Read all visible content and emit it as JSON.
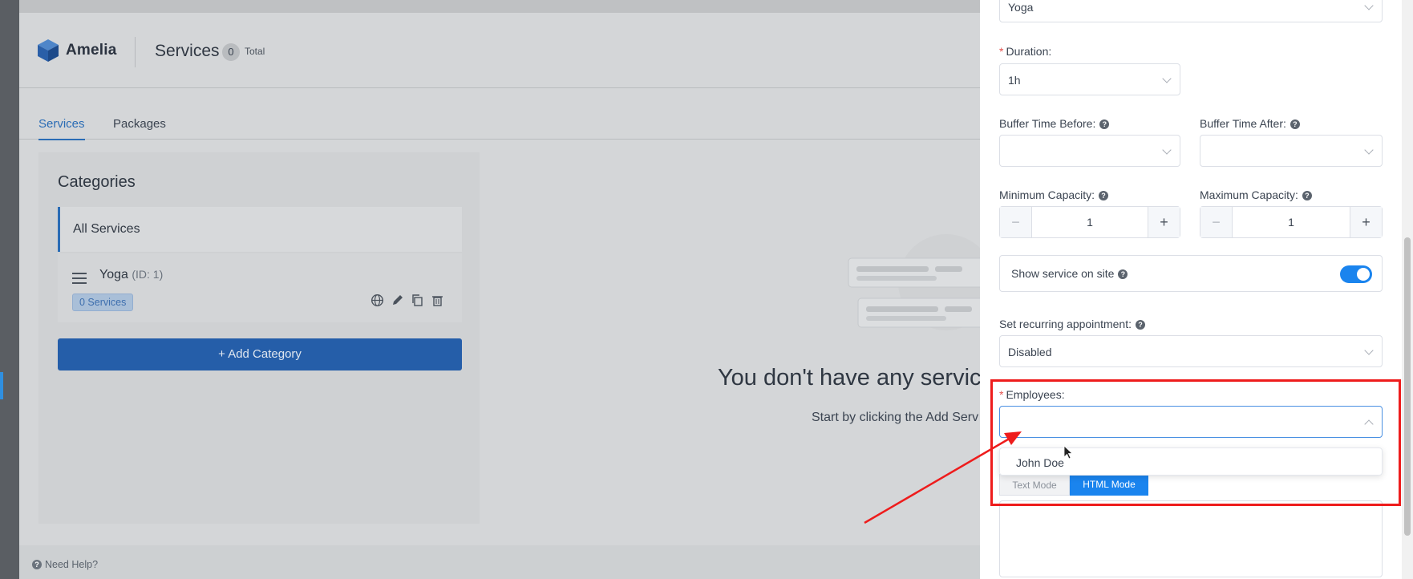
{
  "app": {
    "brand": "Amelia",
    "page_title": "Services",
    "count": "0",
    "count_label": "Total",
    "tabs": [
      {
        "label": "Services",
        "active": true
      },
      {
        "label": "Packages",
        "active": false
      }
    ],
    "categories": {
      "title": "Categories",
      "all_label": "All Services",
      "items": [
        {
          "name": "Yoga",
          "id_label": "(ID: 1)",
          "badge": "0 Services"
        }
      ],
      "add_button": "Add Category"
    },
    "empty": {
      "title": "You don't have any servic",
      "subtitle": "Start by clicking the Add Serv"
    },
    "help": "Need Help?"
  },
  "drawer": {
    "category_value": "Yoga",
    "duration": {
      "label": "Duration:",
      "value": "1h"
    },
    "buffer_before": {
      "label": "Buffer Time Before:",
      "value": ""
    },
    "buffer_after": {
      "label": "Buffer Time After:",
      "value": ""
    },
    "min_capacity": {
      "label": "Minimum Capacity:",
      "value": "1"
    },
    "max_capacity": {
      "label": "Maximum Capacity:",
      "value": "1"
    },
    "show_on_site": {
      "label": "Show service on site",
      "enabled": true
    },
    "recurring": {
      "label": "Set recurring appointment:",
      "value": "Disabled"
    },
    "employees": {
      "label": "Employees:",
      "value": "",
      "options": [
        "John Doe"
      ]
    },
    "modes": {
      "text": "Text Mode",
      "html": "HTML Mode",
      "active": "html"
    }
  },
  "colors": {
    "accent": "#1a84ee",
    "annotation": "#ee1c1c",
    "required": "#e4534f"
  }
}
